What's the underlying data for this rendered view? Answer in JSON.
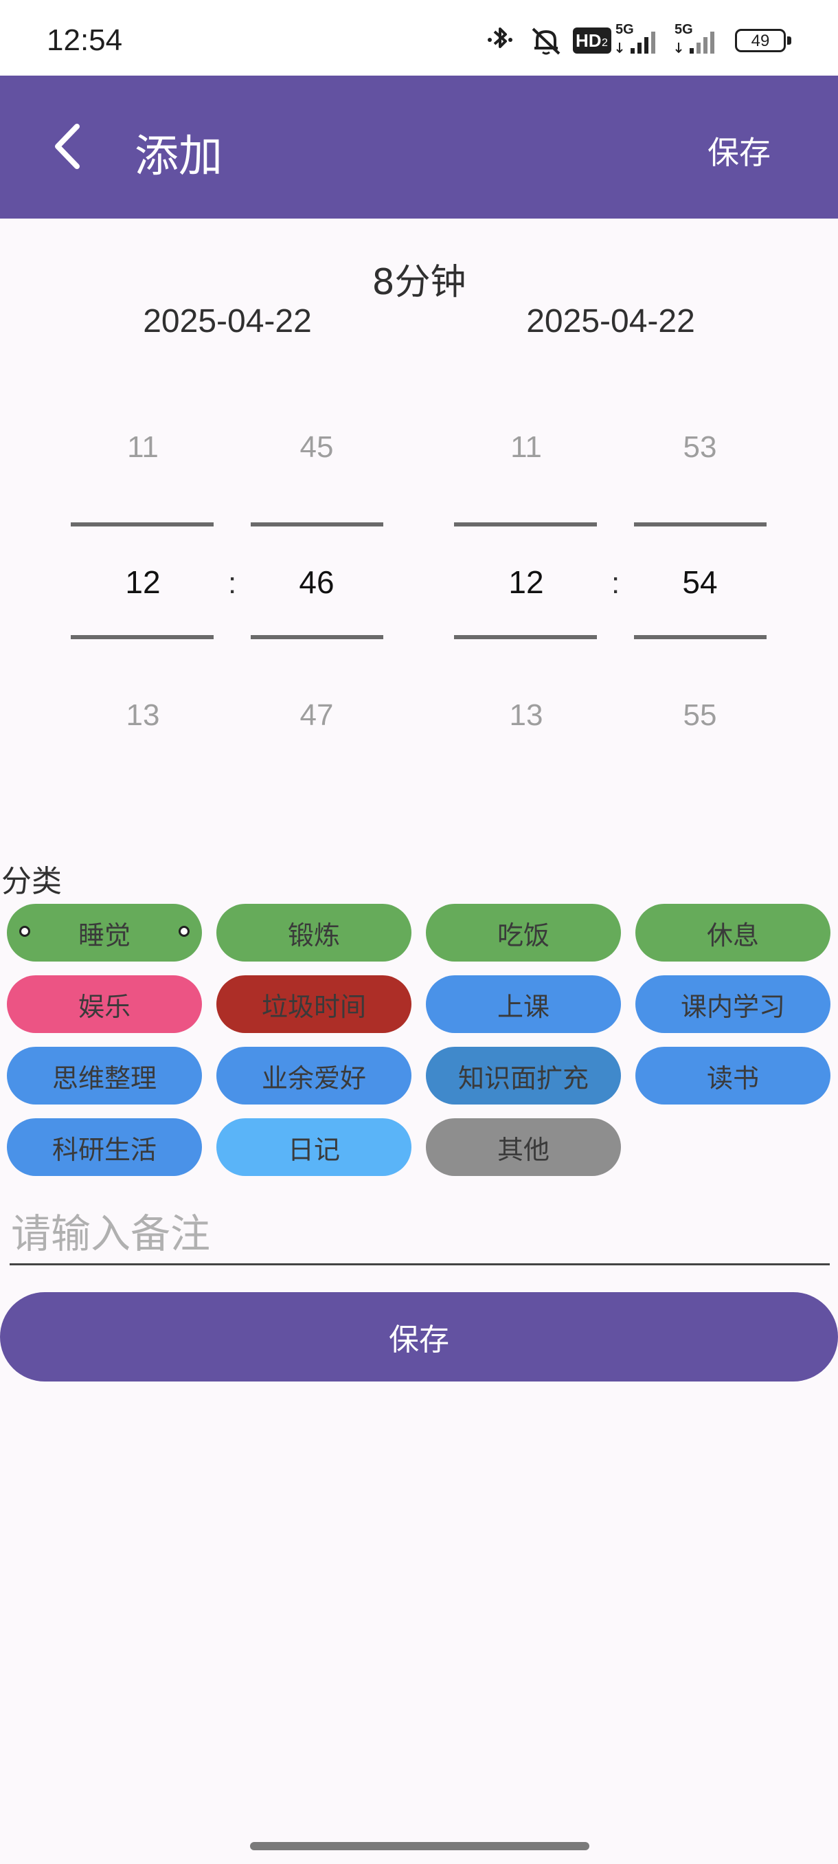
{
  "status_bar": {
    "time": "12:54",
    "network_1": "5G",
    "network_2": "5G",
    "hd_badge": "HD",
    "hd_sub": "2",
    "battery": "49",
    "icons": [
      "bluetooth-icon",
      "mute-icon",
      "hd-icon",
      "signal-icon",
      "signal-icon",
      "battery-icon"
    ]
  },
  "app_bar": {
    "title": "添加",
    "save_label": "保存",
    "background": "#6352a1"
  },
  "duration": "8分钟",
  "start": {
    "date": "2025-04-22",
    "hour": {
      "prev": "11",
      "selected": "12",
      "next": "13"
    },
    "minute": {
      "prev": "45",
      "selected": "46",
      "next": "47"
    }
  },
  "end": {
    "date": "2025-04-22",
    "hour": {
      "prev": "11",
      "selected": "12",
      "next": "13"
    },
    "minute": {
      "prev": "53",
      "selected": "54",
      "next": "55"
    }
  },
  "time_separator": ":",
  "category": {
    "label": "分类",
    "chips": [
      {
        "label": "睡觉",
        "color": "#66ab5a",
        "selected": true
      },
      {
        "label": "锻炼",
        "color": "#66ab5a"
      },
      {
        "label": "吃饭",
        "color": "#66ab5a"
      },
      {
        "label": "休息",
        "color": "#66ab5a"
      },
      {
        "label": "娱乐",
        "color": "#ec5484"
      },
      {
        "label": "垃圾时间",
        "color": "#ad2e27"
      },
      {
        "label": "上课",
        "color": "#4a92e8"
      },
      {
        "label": "课内学习",
        "color": "#4a92e8"
      },
      {
        "label": "思维整理",
        "color": "#4a92e8"
      },
      {
        "label": "业余爱好",
        "color": "#4a92e8"
      },
      {
        "label": "知识面扩充",
        "color": "#4089cb"
      },
      {
        "label": "读书",
        "color": "#4a92e8"
      },
      {
        "label": "科研生活",
        "color": "#4a92e8"
      },
      {
        "label": "日记",
        "color": "#5ab4f8"
      },
      {
        "label": "其他",
        "color": "#8e8e8e"
      }
    ]
  },
  "note": {
    "placeholder": "请输入备注",
    "value": ""
  },
  "save_button": {
    "label": "保存"
  }
}
